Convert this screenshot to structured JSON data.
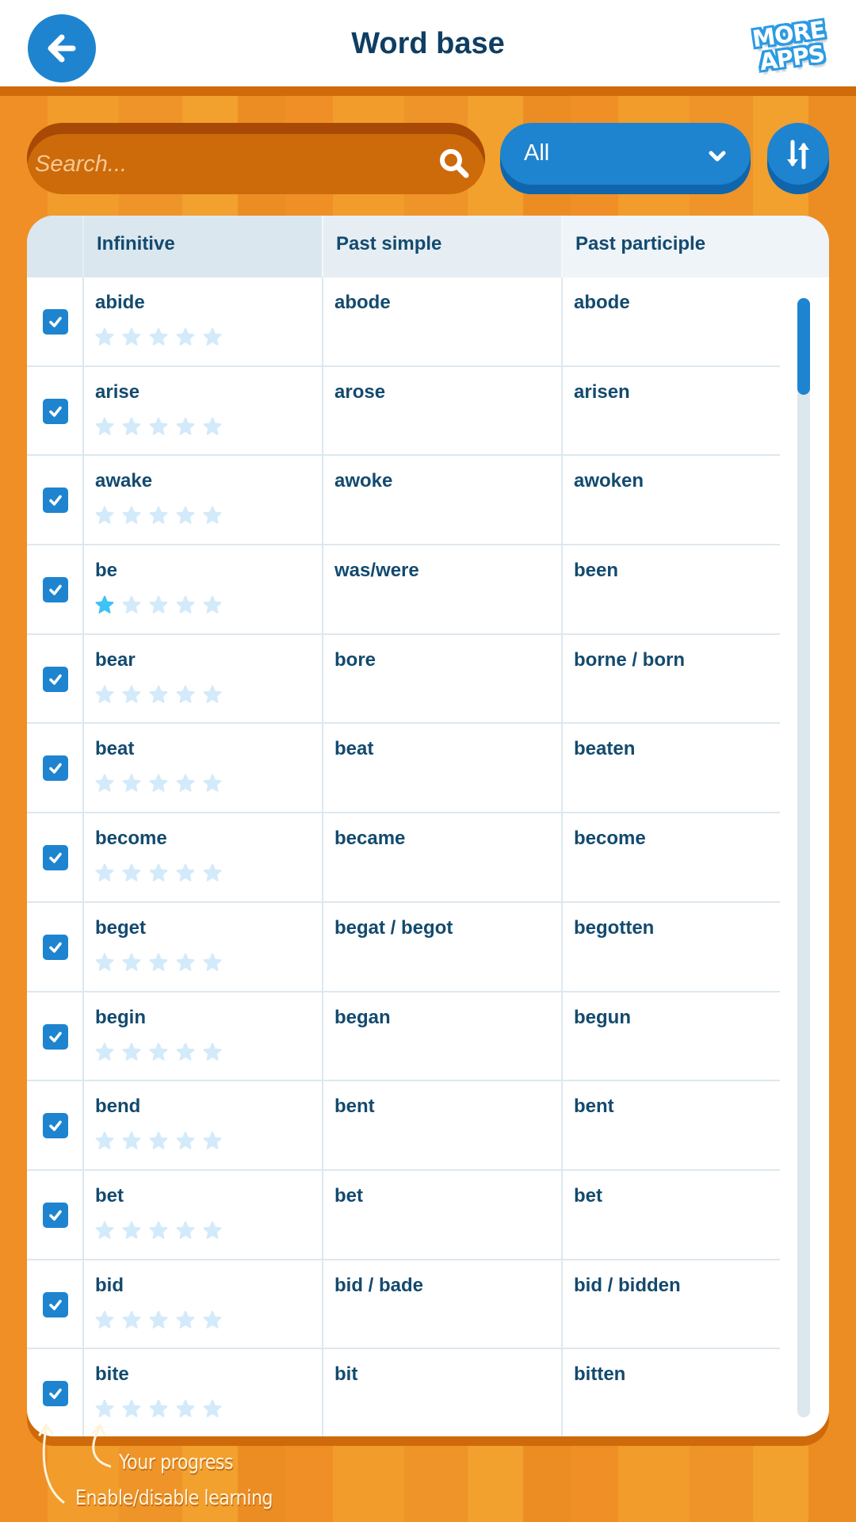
{
  "header": {
    "title": "Word base",
    "back_icon": "arrow-left-icon",
    "more_apps_line1": "MORE",
    "more_apps_line2": "APPS"
  },
  "toolbar": {
    "search_placeholder": "Search...",
    "search_value": "",
    "search_icon": "search-icon",
    "filter_selected": "All",
    "filter_icon": "chevron-down-icon",
    "sort_icon": "sort-arrows-icon"
  },
  "table": {
    "columns": [
      "Infinitive",
      "Past simple",
      "Past participle"
    ],
    "max_stars": 5,
    "rows": [
      {
        "enabled": true,
        "infinitive": "abide",
        "past_simple": "abode",
        "past_participle": "abode",
        "stars": 0
      },
      {
        "enabled": true,
        "infinitive": "arise",
        "past_simple": "arose",
        "past_participle": "arisen",
        "stars": 0
      },
      {
        "enabled": true,
        "infinitive": "awake",
        "past_simple": "awoke",
        "past_participle": "awoken",
        "stars": 0
      },
      {
        "enabled": true,
        "infinitive": "be",
        "past_simple": "was/were",
        "past_participle": "been",
        "stars": 1
      },
      {
        "enabled": true,
        "infinitive": "bear",
        "past_simple": "bore",
        "past_participle": "borne / born",
        "stars": 0
      },
      {
        "enabled": true,
        "infinitive": "beat",
        "past_simple": "beat",
        "past_participle": "beaten",
        "stars": 0
      },
      {
        "enabled": true,
        "infinitive": "become",
        "past_simple": "became",
        "past_participle": "become",
        "stars": 0
      },
      {
        "enabled": true,
        "infinitive": "beget",
        "past_simple": "begat / begot",
        "past_participle": "begotten",
        "stars": 0
      },
      {
        "enabled": true,
        "infinitive": "begin",
        "past_simple": "began",
        "past_participle": "begun",
        "stars": 0
      },
      {
        "enabled": true,
        "infinitive": "bend",
        "past_simple": "bent",
        "past_participle": "bent",
        "stars": 0
      },
      {
        "enabled": true,
        "infinitive": "bet",
        "past_simple": "bet",
        "past_participle": "bet",
        "stars": 0
      },
      {
        "enabled": true,
        "infinitive": "bid",
        "past_simple": "bid / bade",
        "past_participle": "bid / bidden",
        "stars": 0
      },
      {
        "enabled": true,
        "infinitive": "bite",
        "past_simple": "bit",
        "past_participle": "bitten",
        "stars": 0
      }
    ],
    "scroll_position": 0.0
  },
  "hints": {
    "progress": "Your progress",
    "enable": "Enable/disable learning"
  },
  "colors": {
    "primary_blue": "#1e84cf",
    "header_text": "#0f3e62",
    "orange_bg": "#ef8f25",
    "orange_dark": "#cf6b0a",
    "star_filled": "#3ec3f5",
    "star_empty": "#d3eafa"
  }
}
